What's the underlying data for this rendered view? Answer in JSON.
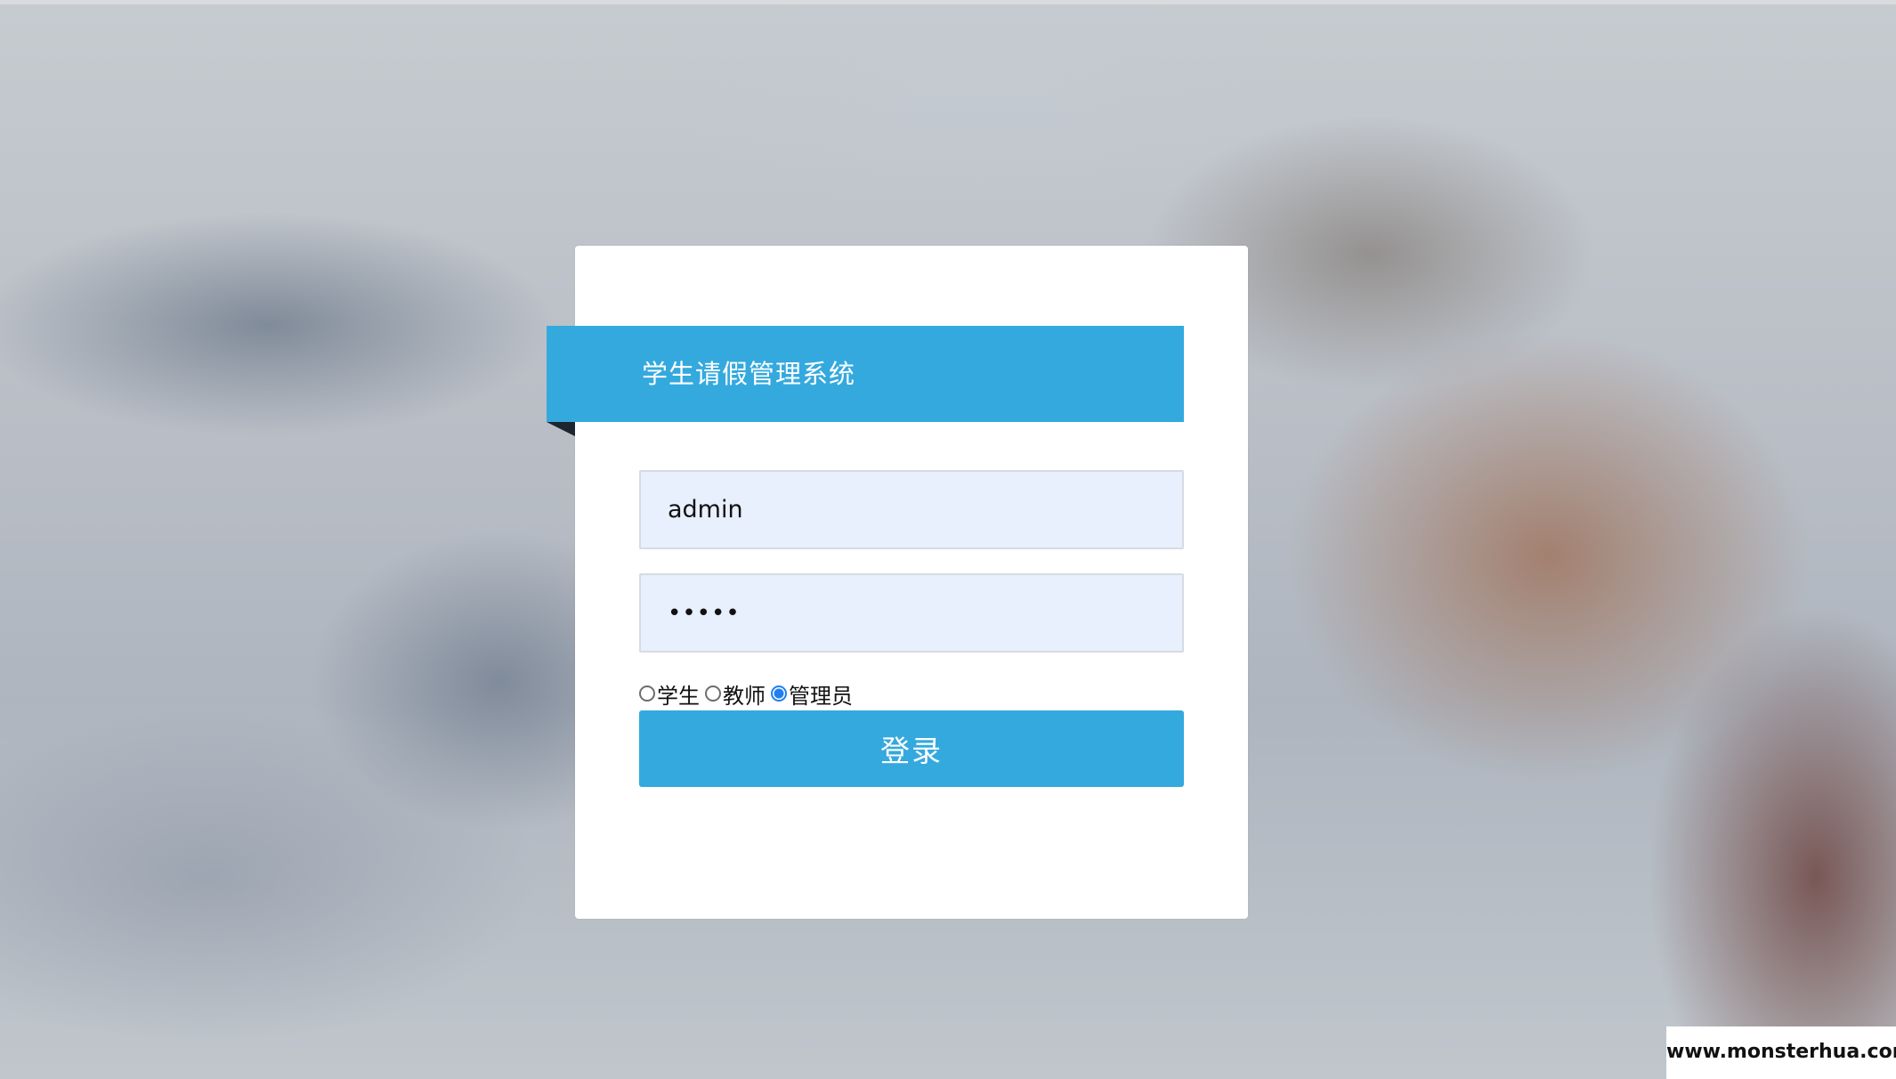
{
  "header": {
    "title": "学生请假管理系统"
  },
  "form": {
    "username_value": "admin",
    "password_value": "•••••",
    "roles": [
      {
        "label": "学生",
        "checked": false
      },
      {
        "label": "教师",
        "checked": false
      },
      {
        "label": "管理员",
        "checked": true
      }
    ],
    "login_label": "登录"
  },
  "watermark": {
    "text": "www.monsterhua.com"
  },
  "colors": {
    "accent": "#34a9de",
    "input_bg": "#e8effd",
    "radio_checked": "#1f7ff0"
  }
}
